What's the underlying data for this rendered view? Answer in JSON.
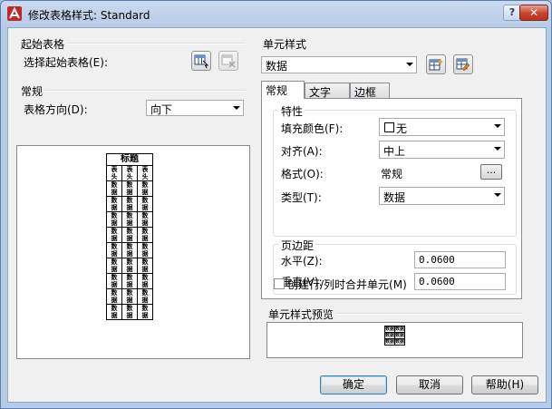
{
  "window": {
    "title": "修改表格样式: Standard",
    "help_glyph": "?",
    "close_glyph": "✕"
  },
  "start_table": {
    "heading": "起始表格",
    "label": "选择起始表格(E):"
  },
  "general": {
    "heading": "常规",
    "direction_label": "表格方向(D):",
    "direction_value": "向下"
  },
  "table_preview": {
    "title": "标题",
    "header_row": [
      "表头",
      "表头",
      "表头"
    ],
    "data_cell": "数据",
    "data_rows": 9
  },
  "cell_style": {
    "heading": "单元样式",
    "selected": "数据",
    "tabs": [
      "常规",
      "文字",
      "边框"
    ],
    "properties": {
      "heading": "特性",
      "fill_label": "填充颜色(F):",
      "fill_value": "无",
      "align_label": "对齐(A):",
      "align_value": "中上",
      "format_label": "格式(O):",
      "format_value": "常规",
      "format_button": "...",
      "type_label": "类型(T):",
      "type_value": "数据"
    },
    "margins": {
      "heading": "页边距",
      "horizontal_label": "水平(Z):",
      "horizontal_value": "0.0600",
      "vertical_label": "垂直(V):",
      "vertical_value": "0.0600"
    },
    "merge_label": "创建行/列时合并单元(M)",
    "merge_checked": false
  },
  "cell_preview": {
    "heading": "单元样式预览",
    "cell": "数据"
  },
  "buttons": {
    "ok": "确定",
    "cancel": "取消",
    "help": "帮助(H)"
  }
}
